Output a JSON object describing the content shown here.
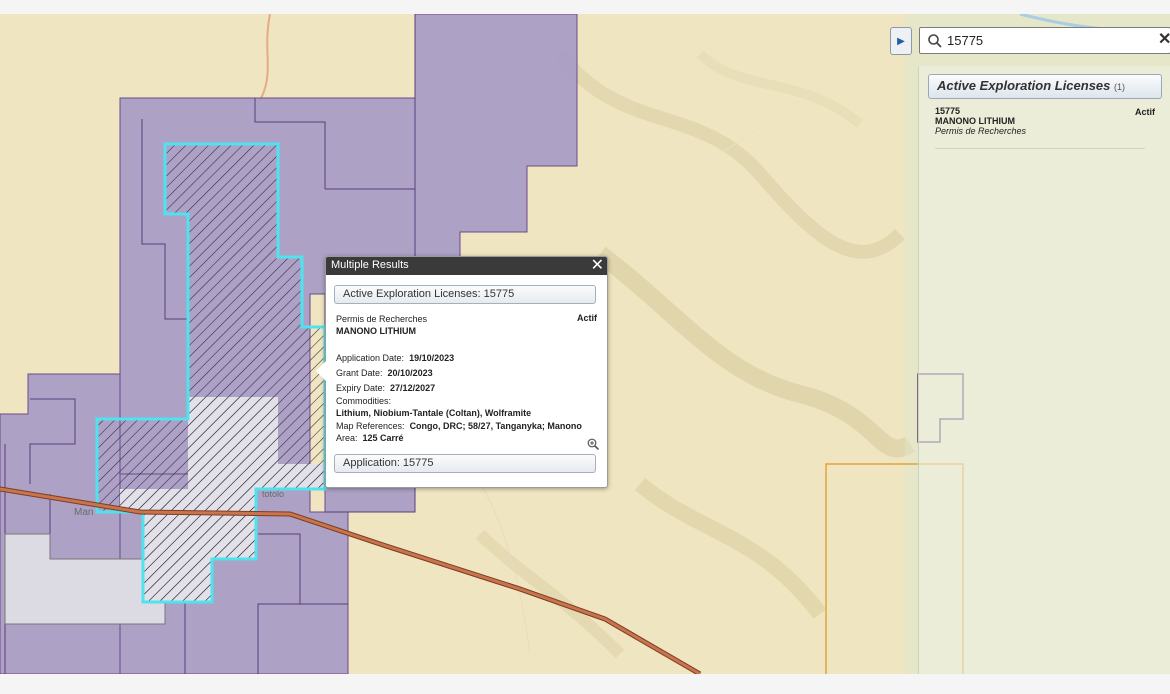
{
  "search": {
    "value": "15775",
    "clear": "✕"
  },
  "panel_toggle": "▶",
  "results_panel": {
    "header": "Active Exploration Licenses",
    "count": "(1)",
    "items": [
      {
        "id": "15775",
        "name": "MANONO LITHIUM",
        "type": "Permis de Recherches",
        "status": "Actif"
      }
    ]
  },
  "popup": {
    "title": "Multiple Results",
    "close": "✕",
    "layer_button": "Active Exploration Licenses: 15775",
    "type": "Permis de Recherches",
    "status": "Actif",
    "name": "MANONO LITHIUM",
    "application_date_label": "Application Date:",
    "application_date": "19/10/2023",
    "grant_date_label": "Grant Date:",
    "grant_date": "20/10/2023",
    "expiry_date_label": "Expiry Date:",
    "expiry_date": "27/12/2027",
    "commodities_label": "Commodities:",
    "commodities": "Lithium, Niobium-Tantale (Coltan), Wolframite",
    "map_references_label": "Map References:",
    "map_references": "Congo, DRC; 58/27, Tanganyka; Manono",
    "area_label": "Area:",
    "area": "125 Carré",
    "application_button": "Application: 15775"
  },
  "map_labels": {
    "town_left": "Man",
    "town_mid": "totolo"
  },
  "colors": {
    "license_fill": "#a79cc6",
    "license_border": "#5a3d7a",
    "selected_outline": "#4fe3f0",
    "road": "#b2623d",
    "orange_boundary": "#e3a43a"
  }
}
